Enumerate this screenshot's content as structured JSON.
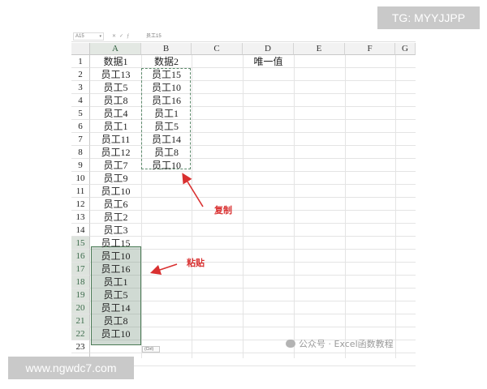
{
  "formula_bar": {
    "name_box": "A15",
    "cell_content": "员工15"
  },
  "columns": [
    "A",
    "B",
    "C",
    "D",
    "E",
    "F",
    "G"
  ],
  "rows": [
    "1",
    "2",
    "3",
    "4",
    "5",
    "6",
    "7",
    "8",
    "9",
    "10",
    "11",
    "12",
    "13",
    "14",
    "15",
    "16",
    "17",
    "18",
    "19",
    "20",
    "21",
    "22",
    "23",
    "24"
  ],
  "column_a": [
    "数据1",
    "员工13",
    "员工5",
    "员工8",
    "员工4",
    "员工1",
    "员工11",
    "员工12",
    "员工7",
    "员工9",
    "员工10",
    "员工6",
    "员工2",
    "员工3",
    "员工15",
    "员工10",
    "员工16",
    "员工1",
    "员工5",
    "员工14",
    "员工8",
    "员工10"
  ],
  "column_b": [
    "数据2",
    "员工15",
    "员工10",
    "员工16",
    "员工1",
    "员工5",
    "员工14",
    "员工8",
    "员工10"
  ],
  "d1": "唯一值",
  "annotations": {
    "copy": "复制",
    "paste": "粘贴"
  },
  "paste_options_tag": "(Ctrl)",
  "watermarks": {
    "wechat": "公众号 · Excel函数教程",
    "tg": "TG: MYYJJPP",
    "site": "www.ngwdc7.com"
  },
  "colors": {
    "selection_fill": "#7a9682",
    "selection_border": "#4a7a55",
    "copy_border": "#5c8a6b",
    "annotation_red": "#d93030",
    "watermark_bg": "#c9c9c9"
  },
  "icons": [
    "wechat-icon",
    "arrow-icon",
    "dropdown-icon"
  ]
}
